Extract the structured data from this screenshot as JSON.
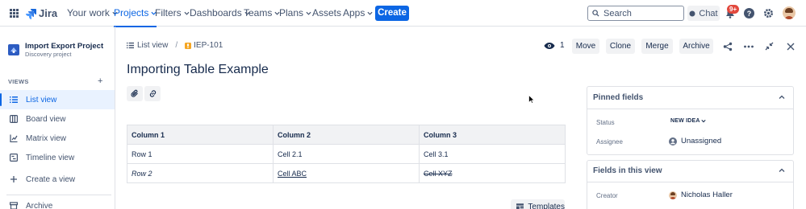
{
  "topnav": {
    "app_name": "Jira",
    "items": [
      {
        "label": "Your work"
      },
      {
        "label": "Projects"
      },
      {
        "label": "Filters"
      },
      {
        "label": "Dashboards"
      },
      {
        "label": "Teams"
      },
      {
        "label": "Plans"
      },
      {
        "label": "Assets"
      },
      {
        "label": "Apps"
      }
    ],
    "create_label": "Create",
    "search_placeholder": "Search",
    "chat_label": "Chat",
    "notifications_badge": "9+"
  },
  "sidebar": {
    "project_name": "Import Export Project",
    "project_type": "Discovery project",
    "views_header": "VIEWS",
    "items": [
      {
        "label": "List view"
      },
      {
        "label": "Board view"
      },
      {
        "label": "Matrix view"
      },
      {
        "label": "Timeline view"
      },
      {
        "label": "Create a view"
      },
      {
        "label": "Archive"
      }
    ]
  },
  "breadcrumb": {
    "view": "List view",
    "separator": "/",
    "issue_key": "IEP-101"
  },
  "header_actions": {
    "watch_count": "1",
    "move": "Move",
    "clone": "Clone",
    "merge": "Merge",
    "archive": "Archive"
  },
  "issue": {
    "title": "Importing Table Example"
  },
  "table": {
    "headers": [
      "Column 1",
      "Column 2",
      "Column 3"
    ],
    "rows": [
      [
        "Row 1",
        "Cell 2.1",
        "Cell 3.1"
      ],
      [
        "Row 2",
        "Cell ABC",
        "Cell XYZ"
      ]
    ]
  },
  "templates_label": "Templates",
  "pinned_fields": {
    "title": "Pinned fields",
    "status_label": "Status",
    "status_value": "NEW IDEA",
    "assignee_label": "Assignee",
    "assignee_value": "Unassigned"
  },
  "fields_in_view": {
    "title": "Fields in this view",
    "creator_label": "Creator",
    "creator_value": "Nicholas Haller"
  },
  "colors": {
    "accent": "#0c66e4",
    "badge": "#e2483d"
  }
}
